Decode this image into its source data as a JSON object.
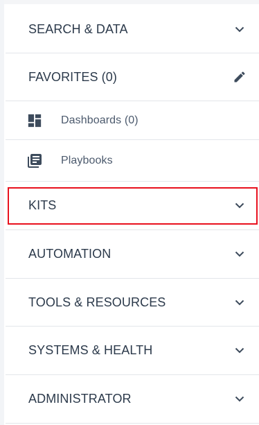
{
  "sidebar": {
    "sections": {
      "search_data": {
        "label": "SEARCH & DATA",
        "icon": "chevron-down-icon"
      },
      "favorites": {
        "label": "FAVORITES (0)",
        "icon": "pencil-icon"
      },
      "dashboards": {
        "label": "Dashboards (0)",
        "icon": "dashboard-icon"
      },
      "playbooks": {
        "label": "Playbooks",
        "icon": "library-books-icon"
      },
      "kits": {
        "label": "KITS",
        "icon": "chevron-down-icon",
        "highlighted": true
      },
      "automation": {
        "label": "AUTOMATION",
        "icon": "chevron-down-icon"
      },
      "tools_resources": {
        "label": "TOOLS & RESOURCES",
        "icon": "chevron-down-icon"
      },
      "systems_health": {
        "label": "SYSTEMS & HEALTH",
        "icon": "chevron-down-icon"
      },
      "administrator": {
        "label": "ADMINISTRATOR",
        "icon": "chevron-down-icon"
      }
    }
  },
  "colors": {
    "text_primary": "#2c3a4b",
    "text_secondary": "#4c5a6d",
    "icon": "#3d4b5c",
    "divider": "#e3e6ea",
    "highlight": "#e8101d"
  }
}
